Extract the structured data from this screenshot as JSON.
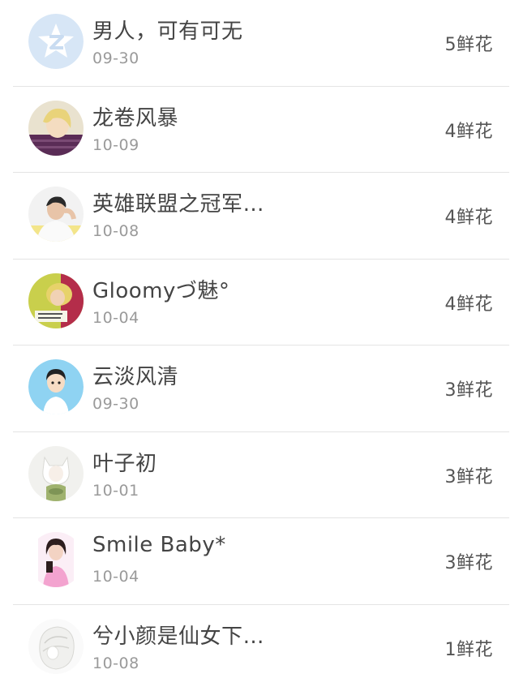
{
  "items": [
    {
      "name": "男人，可有可无",
      "date": "09-30",
      "flowers": "5鲜花",
      "avatar_icon": "qzone-default-avatar-icon"
    },
    {
      "name": "龙卷风暴",
      "date": "10-09",
      "flowers": "4鲜花",
      "avatar_icon": "anime-boy-avatar-icon"
    },
    {
      "name": "英雄联盟之冠军…",
      "date": "10-08",
      "flowers": "4鲜花",
      "avatar_icon": "man-photo-avatar-icon"
    },
    {
      "name": "Gloomyづ魅°",
      "date": "10-04",
      "flowers": "4鲜花",
      "avatar_icon": "girl-photo-avatar-icon"
    },
    {
      "name": "云淡风清",
      "date": "09-30",
      "flowers": "3鲜花",
      "avatar_icon": "cartoon-boy-avatar-icon"
    },
    {
      "name": "叶子初",
      "date": "10-01",
      "flowers": "3鲜花",
      "avatar_icon": "anime-fox-girl-avatar-icon"
    },
    {
      "name": "Smile Baby*",
      "date": "10-04",
      "flowers": "3鲜花",
      "avatar_icon": "woman-pink-avatar-icon"
    },
    {
      "name": "兮小颜是仙女下…",
      "date": "10-08",
      "flowers": "1鲜花",
      "avatar_icon": "sketch-girl-avatar-icon"
    }
  ]
}
